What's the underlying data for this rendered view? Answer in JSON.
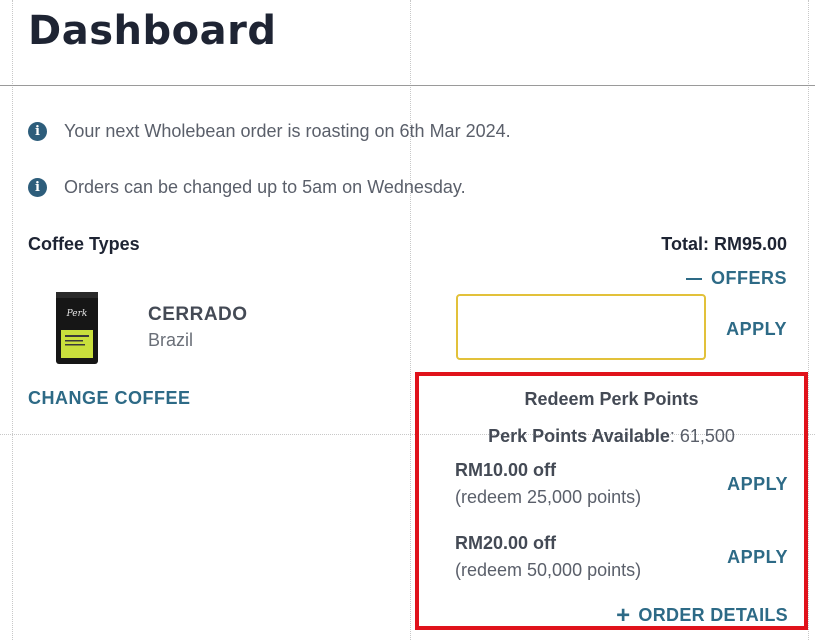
{
  "page": {
    "title": "Dashboard"
  },
  "notices": [
    {
      "icon": "info-icon",
      "glyph": "i",
      "text": "Your next Wholebean order is roasting on 6th Mar 2024."
    },
    {
      "icon": "info-icon",
      "glyph": "i",
      "text": "Orders can be changed up to 5am on Wednesday."
    }
  ],
  "order": {
    "section_label": "Coffee Types",
    "total_label": "Total: RM95.00",
    "offers_label": "OFFERS",
    "coffee": {
      "name": "CERRADO",
      "origin": "Brazil",
      "bag_brand": "Perk"
    },
    "change_coffee_label": "CHANGE COFFEE",
    "offer_input": {
      "value": "",
      "placeholder": ""
    },
    "apply_offer_label": "APPLY"
  },
  "perk": {
    "title": "Redeem Perk Points",
    "available_label": "Perk Points Available",
    "available_value": ": 61,500",
    "rewards": [
      {
        "amount": "RM10.00 off",
        "detail": "(redeem 25,000 points)",
        "apply_label": "APPLY"
      },
      {
        "amount": "RM20.00 off",
        "detail": "(redeem 50,000 points)",
        "apply_label": "APPLY"
      }
    ],
    "order_details_label": "ORDER DETAILS"
  },
  "colors": {
    "accent": "#2d6a86",
    "highlight_border": "#e0121b",
    "input_border": "#e2c13a",
    "info_icon": "#2d5d7b"
  }
}
